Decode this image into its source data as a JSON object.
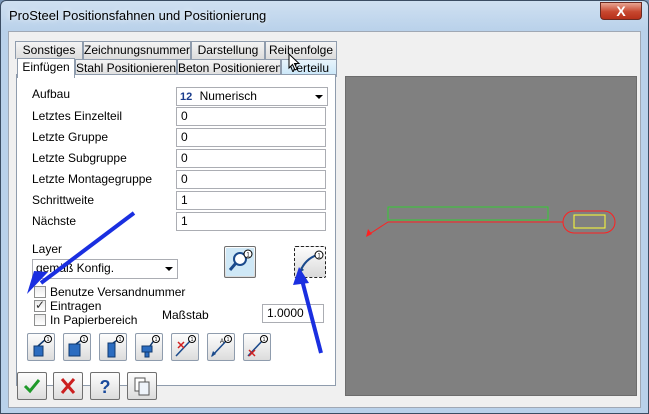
{
  "window": {
    "title": "ProSteel Positionsfahnen und Positionierung",
    "close_label": "X"
  },
  "tabs": {
    "row1": [
      "Sonstiges",
      "Zeichnungsnummer",
      "Darstellung",
      "Reihenfolge"
    ],
    "row2": [
      "Einfügen",
      "Stahl Positionieren",
      "Beton Positionieren",
      "Verteilu"
    ],
    "active": "Einfügen"
  },
  "form": {
    "aufbau": {
      "label": "Aufbau",
      "value": "Numerisch",
      "prefix": "12"
    },
    "rows": [
      {
        "label": "Letztes Einzelteil",
        "value": "0"
      },
      {
        "label": "Letzte Gruppe",
        "value": "0"
      },
      {
        "label": "Letzte Subgruppe",
        "value": "0"
      },
      {
        "label": "Letzte Montagegruppe",
        "value": "0"
      },
      {
        "label": "Schrittweite",
        "value": "1"
      },
      {
        "label": "Nächste",
        "value": "1"
      }
    ],
    "layer": {
      "label": "Layer",
      "value": "gemäß Konfig."
    },
    "checkboxes": [
      {
        "label": "Benutze Versandnummer",
        "checked": false
      },
      {
        "label": "Eintragen",
        "checked": true
      },
      {
        "label": "In Papierbereich",
        "checked": false
      }
    ],
    "massstab": {
      "label": "Maßstab",
      "value": "1.0000"
    }
  },
  "colors": {
    "preview_bg": "#808080",
    "annotation_arrow": "#1a2fe0",
    "green_rect": "#33cc33",
    "red_line": "#ff2020",
    "yellow_rect": "#ffff33"
  },
  "icons": {
    "tools": [
      "position-flag-a-icon",
      "position-flag-b-icon",
      "position-flag-c-icon",
      "position-flag-d-icon",
      "position-leader-cross-icon",
      "position-leader-a-icon",
      "position-leader-x-icon"
    ],
    "footer": [
      "ok-check-icon",
      "cancel-x-icon",
      "help-question-icon",
      "copy-document-icon"
    ]
  }
}
